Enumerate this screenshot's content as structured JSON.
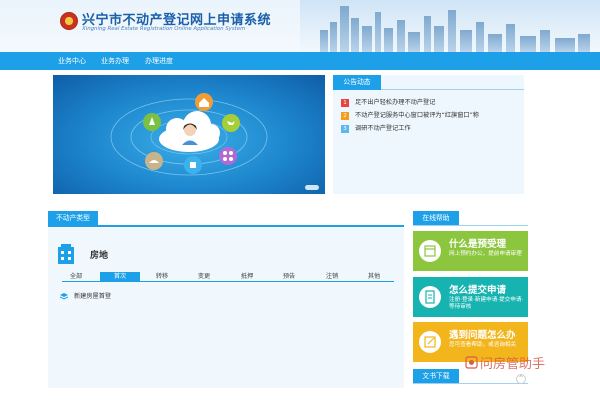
{
  "header": {
    "title": "兴宁市不动产登记网上申请系统",
    "subtitle": "Xingning Real Estate Registration Online Application System"
  },
  "nav": {
    "items": [
      {
        "label": "业务中心"
      },
      {
        "label": "业务办理"
      },
      {
        "label": "办理进度"
      }
    ]
  },
  "notices": {
    "tab_label": "公告动态",
    "items": [
      {
        "num": "1",
        "text": "足不出户轻松办理不动产登记",
        "color": "#e8463c"
      },
      {
        "num": "2",
        "text": "不动产登记服务中心窗口被评为“红旗窗口”称",
        "color": "#f59d1c"
      },
      {
        "num": "3",
        "text": "调研不动产登记工作",
        "color": "#5cb8ea"
      }
    ]
  },
  "property": {
    "section_label": "不动产类型",
    "title": "房地",
    "tabs": [
      {
        "label": "全部",
        "active": false
      },
      {
        "label": "首次",
        "active": true
      },
      {
        "label": "转移",
        "active": false
      },
      {
        "label": "变更",
        "active": false
      },
      {
        "label": "抵押",
        "active": false
      },
      {
        "label": "预告",
        "active": false
      },
      {
        "label": "注销",
        "active": false
      },
      {
        "label": "其他",
        "active": false
      }
    ],
    "sub_items": [
      {
        "label": "新建房屋首登"
      }
    ]
  },
  "help": {
    "tab_label": "在线帮助",
    "cards": [
      {
        "title": "什么是预受理",
        "desc": "网上预约办公，提前申请审理",
        "color": "#8cc63f",
        "icon": "calendar-icon"
      },
      {
        "title": "怎么提交申请",
        "desc": "注册·登录·新建申请·提交申请·等待审核",
        "color": "#16b3b0",
        "icon": "document-icon"
      },
      {
        "title": "遇到问题怎么办",
        "desc": "您可查看帮助，或咨询相关",
        "color": "#f2b51c",
        "icon": "edit-icon"
      }
    ]
  },
  "docs": {
    "tab_label": "文书下载"
  },
  "watermark": {
    "text": "问房管助手"
  },
  "colors": {
    "primary": "#1ea0e8",
    "title_blue": "#1a5fa8"
  }
}
